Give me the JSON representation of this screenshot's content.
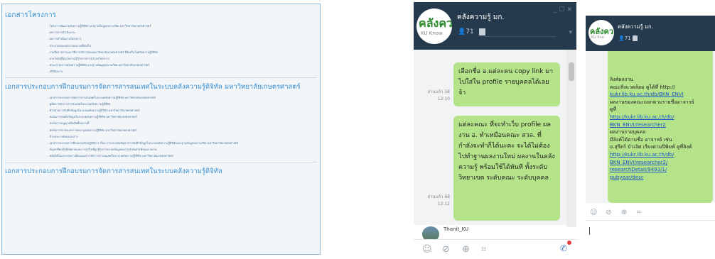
{
  "doc": {
    "section1_title": "เอกสารโครงการ",
    "section1_items": [
      "- โครงการพัฒนาคลังความรู้ดิจิทัล และฐานข้อมูลผลงานวิจัย มหาวิทยาลัยเกษตรศาสตร์",
      "- ผลการการดำเนินงาน",
      "- ผลการดำเนินงานโครงการ",
      "- ประมวลของเอกสารผลงานที่จัดเก็บ",
      "- รายชื่อรายการและวิธีการบริการของมหาวิทยาลัยเกษตรศาสตร์ ที่จัดเก็บในคลังความรู้ดิจิทัล",
      "- ประโยชน์ที่หน่วยงานได้รับจากการนำร่องโครงการ",
      "- คณะกรรมการคลังความรู้ดิจิทัล และฐานข้อมูลผลงานวิจัย มหาวิทยาลัยเกษตรศาสตร์",
      "- สถิติผลงาน"
    ],
    "section2_title": "เอกสารประกอบการฝึกอบรมการจัดการสารสนเทศในระบบคลังความรู้ดิจิทัล มหาวิทยาลัยเกษตรศาสตร์",
    "section2_items": [
      "- เอกสารประกอบการจัดการสารสนเทศในระบบคลังความรู้ดิจิทัล มหาวิทยาลัยเกษตรศาสตร์",
      "- คู่มือการจัดการสารสนเทศในระบบคลังความรู้ดิจิทัล",
      "- ตัวอย่างการบันทึกข้อมูลในระบบคลังความรู้ดิจิทัล มหาวิทยาลัยเกษตรศาสตร์",
      "- ฟอร์มการบันทึกข้อมูลในระบบคลังความรู้ดิจิทัล มหาวิทยาลัยเกษตรศาสตร์",
      "- ฟอร์มการอนุญาตลิขสิทธิ์ผลงานนี้",
      "- ฟอร์มการนำส่งเอกสารผลงานคลังความรู้ดิจิทัล มหาวิทยาลัยเกษตรศาสตร์",
      "- ป้ายประกาศของเอกสาร",
      "- เอกสารประกอบการฝึกอบรมเชิงปฏิบัติการ เรื่อง การประเมินปัญหาการบันทึกข้อมูลในระบบคลังความรู้ดิจิทัลและฐานข้อมูลผลงานวิจัย มหาวิทยาลัยเกษตรศาสตร์",
      "- ปัญหาที่พบข้อผิดพลาดและการแก้ไขที่ถูกต้องการกรอกข้อมูลผลงานลำดับสรรพ์ของลายงาน",
      "- คลิปวิดีโอประกอบการฝึกอบรมการจัดการสารสนเทศในระบบคลังความรู้ดิจิทัล มหาวิทยาลัยเกษตรศาสตร์"
    ],
    "section3_title": "เอกสารประกอบการฝึกอบรมการจัดการสารสนเทศในระบบคลังความรู้ดิจิทัล"
  },
  "chat1": {
    "logo_big": "คลังควา",
    "logo_small": "KU Know",
    "name": "คลังความรู้ มก.",
    "member_count": "71",
    "window_controls": "_ ☐ ✕",
    "msg1": "เลือกชื่อ อ.แต่ละคน copy link มาไปใส่ใน profile รายบุคคลได้เลยจ้า",
    "msg1_read": "อ่านแล้ว 58",
    "msg1_time": "12:10",
    "msg2": "แต่ละคณะ ที่จะทำเว็บ profile ผลงาน อ. ทำเหมือนคณะ สวล. ที่กำลังจะทำก็ได้นะคะ จะได้ไม่ต้องไปทำฐานผลงานใหม่ ผลงานในคลังความรู้ พร้อมใช้ได้ทันที ทั้งระดับ วิทยาเขต ระดับคณะ ระดับบุคคล",
    "msg2_read": "อ่านแล้ว 68",
    "msg2_time": "12:12",
    "sender": "Thanit_KU"
  },
  "chat2": {
    "logo_big": "คลังคว",
    "logo_small": "KU Kno",
    "name": "คลังความรู้ มก.",
    "member_count": "71",
    "lines": [
      {
        "kind": "txt",
        "text": "ลิงค์ผลงาน"
      },
      {
        "kind": "txt",
        "text": "คณะสิ่งแวดล้อม ดูได้ที่ http://"
      },
      {
        "kind": "lnk",
        "text": "kukr.lib.ku.ac.th/db/BKN_ENVI"
      },
      {
        "kind": "txt",
        "text": "ผลงานของคณะแยกตามรายชื่ออาจารย์ ดูที่"
      },
      {
        "kind": "lnk",
        "text": "http://kukr.lib.ku.ac.th/db/"
      },
      {
        "kind": "lnk",
        "text": "BKN_ENVI/researcher2"
      },
      {
        "kind": "txt",
        "text": "ผลงานรายบุคคล"
      },
      {
        "kind": "txt",
        "text": "มีลิงค์ได้ตามชื่อ อาจารย์ เช่น"
      },
      {
        "kind": "txt",
        "text": "อ.สุรีดร์ บัวเลิศ เรียงตามปีพิมพ์ ดูที่ลิงค์"
      },
      {
        "kind": "lnk",
        "text": "http://kukr.lib.ku.ac.th/db/"
      },
      {
        "kind": "lnk",
        "text": "BKN_ENVI/researcher2/"
      },
      {
        "kind": "lnk",
        "text": "researchDetail/9493/1/"
      },
      {
        "kind": "lnk",
        "text": "pubyear/desc"
      }
    ]
  },
  "icons": {
    "emoji": "☺",
    "attach": "⊘",
    "download": "⊕",
    "crop": "⌗",
    "phone": "✆",
    "person": "👤",
    "dropdown": "▾"
  }
}
